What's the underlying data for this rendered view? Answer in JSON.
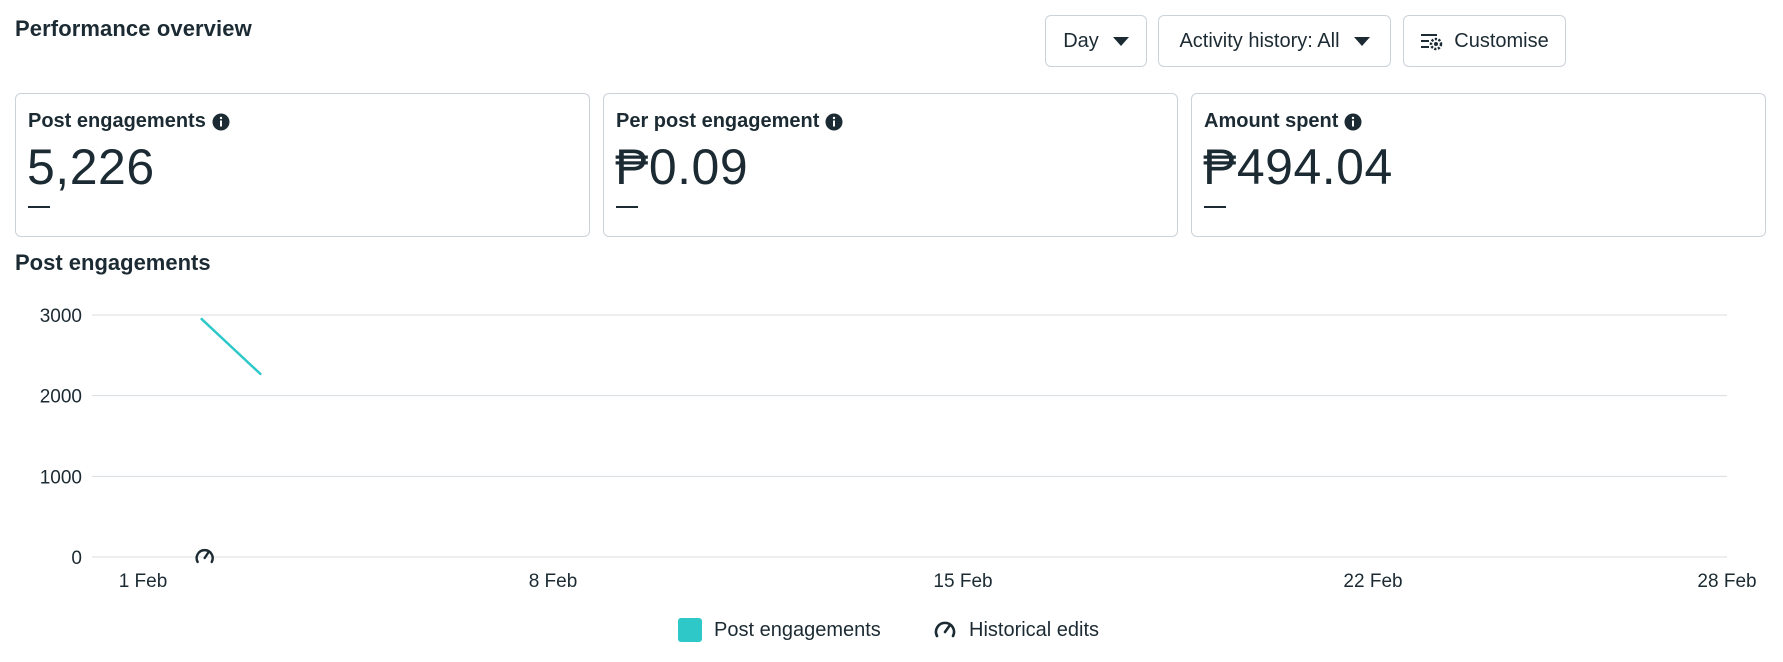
{
  "header": {
    "title": "Performance overview",
    "controls": {
      "period_label": "Day",
      "activity_label": "Activity history: All",
      "customise_label": "Customise"
    }
  },
  "metrics": [
    {
      "label": "Post engagements",
      "value": "5,226",
      "comparison": "—"
    },
    {
      "label": "Per post engagement",
      "value": "₱0.09",
      "comparison": "—"
    },
    {
      "label": "Amount spent",
      "value": "₱494.04",
      "comparison": "—"
    }
  ],
  "chart_section": {
    "title": "Post engagements"
  },
  "chart_data": {
    "type": "line",
    "title": "Post engagements",
    "xlabel": "",
    "ylabel": "",
    "x_ticks": [
      "1 Feb",
      "8 Feb",
      "15 Feb",
      "22 Feb",
      "28 Feb"
    ],
    "y_ticks": [
      "0",
      "1000",
      "2000",
      "3000"
    ],
    "xlim": [
      "1 Feb",
      "28 Feb"
    ],
    "ylim": [
      0,
      3000
    ],
    "grid": true,
    "legend": "bottom",
    "series": [
      {
        "name": "Post engagements",
        "color": "#2ec8c9",
        "points": [
          {
            "x": "2 Feb",
            "y": 2950
          },
          {
            "x": "3 Feb",
            "y": 2270
          }
        ]
      }
    ],
    "markers": [
      {
        "name": "Historical edits",
        "x": "2 Feb",
        "icon": "gauge-icon"
      }
    ]
  },
  "legend": {
    "items": [
      {
        "label": "Post engagements",
        "icon": "teal-swatch",
        "color": "#2ec8c9"
      },
      {
        "label": "Historical edits",
        "icon": "gauge-icon"
      }
    ]
  }
}
